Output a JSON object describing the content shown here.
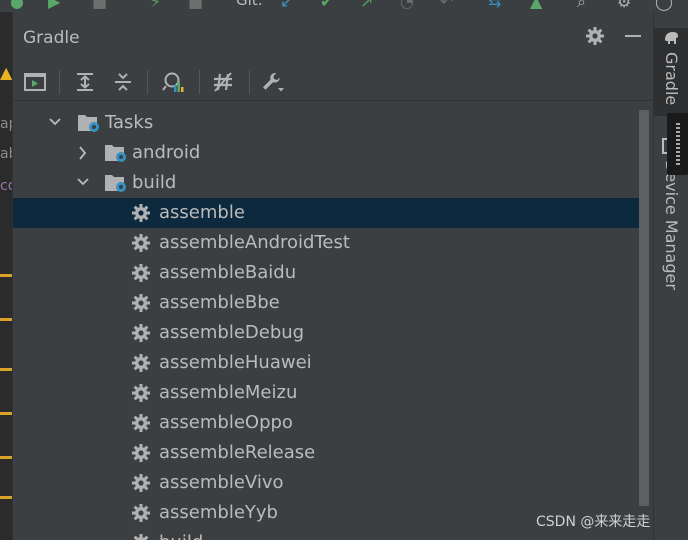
{
  "top_toolbar": {
    "git_label": "Git:"
  },
  "panel": {
    "title": "Gradle",
    "settings_icon": "gear-icon",
    "minimize_icon": "minus-icon"
  },
  "toolbar": {
    "tools": [
      {
        "name": "run-task-icon"
      },
      {
        "name": "expand-all-icon"
      },
      {
        "name": "collapse-all-icon"
      },
      {
        "name": "analyze-dependencies-icon"
      },
      {
        "name": "toggle-offline-icon"
      },
      {
        "name": "build-settings-icon"
      }
    ]
  },
  "tree": {
    "rows": [
      {
        "label": "Tasks",
        "arrow": "expanded",
        "icon": "folder-gear-icon"
      },
      {
        "label": "android",
        "arrow": "collapsed",
        "icon": "folder-gear-icon"
      },
      {
        "label": "build",
        "arrow": "expanded",
        "icon": "folder-gear-icon"
      },
      {
        "label": "assemble",
        "icon": "gear-icon",
        "selected": true
      },
      {
        "label": "assembleAndroidTest",
        "icon": "gear-icon"
      },
      {
        "label": "assembleBaidu",
        "icon": "gear-icon"
      },
      {
        "label": "assembleBbe",
        "icon": "gear-icon"
      },
      {
        "label": "assembleDebug",
        "icon": "gear-icon"
      },
      {
        "label": "assembleHuawei",
        "icon": "gear-icon"
      },
      {
        "label": "assembleMeizu",
        "icon": "gear-icon"
      },
      {
        "label": "assembleOppo",
        "icon": "gear-icon"
      },
      {
        "label": "assembleRelease",
        "icon": "gear-icon"
      },
      {
        "label": "assembleVivo",
        "icon": "gear-icon"
      },
      {
        "label": "assembleYyb",
        "icon": "gear-icon"
      },
      {
        "label": "build",
        "icon": "gear-icon"
      }
    ]
  },
  "right_strip": {
    "tabs": [
      {
        "label": "Gradle",
        "icon": "gradle-elephant-icon",
        "active": true
      },
      {
        "label": "Device Manager",
        "icon": "device-icon",
        "active": false
      }
    ]
  },
  "watermark": "CSDN @来来走走",
  "colors": {
    "panel_bg": "#3c3f41",
    "selection_bg": "#0d293e",
    "text": "#bbbbbb",
    "task_icon": "#afb1b3",
    "folder_badge": "#3592c4"
  }
}
